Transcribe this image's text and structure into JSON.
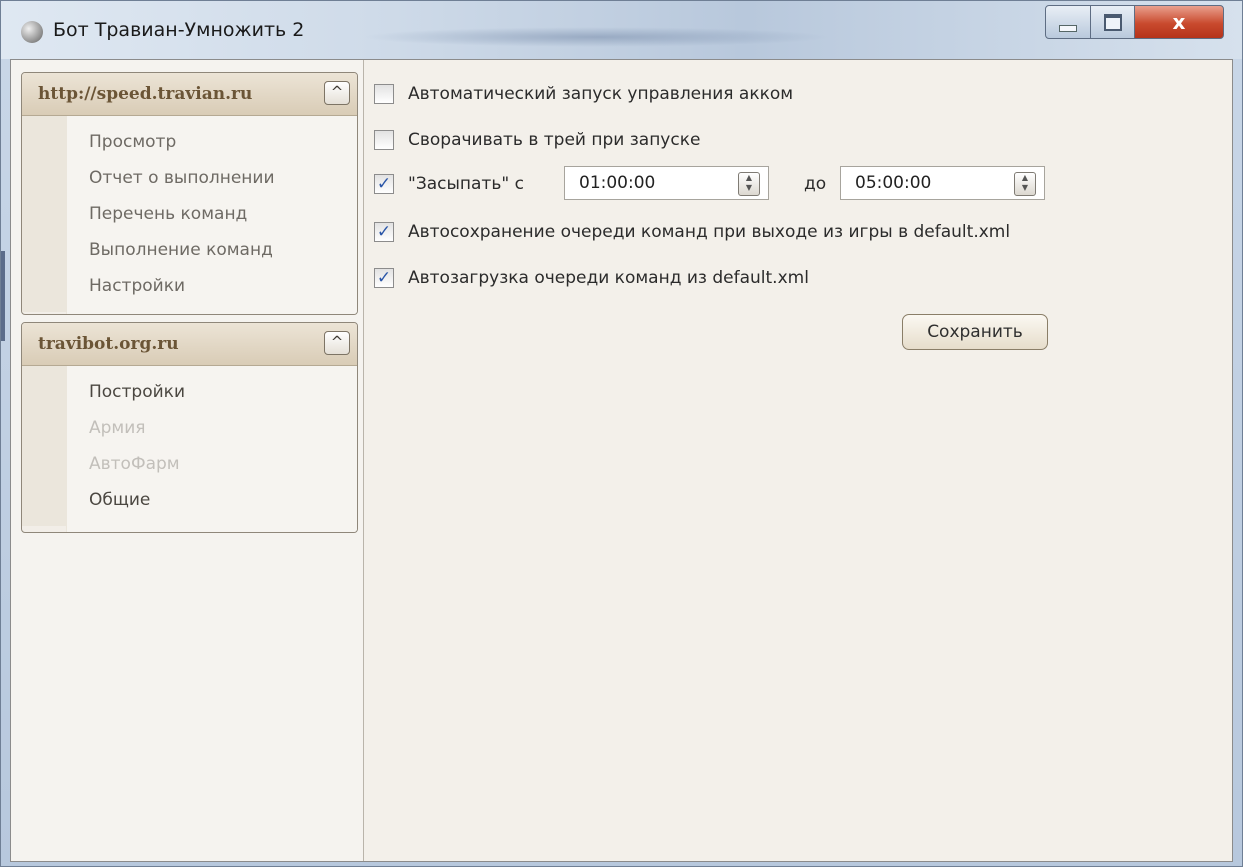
{
  "window": {
    "title": "Бот Травиан-Умножить 2",
    "close_glyph": "x",
    "icon": "app-helmet-icon"
  },
  "sidebar": {
    "panels": [
      {
        "title": "http://speed.travian.ru",
        "collapse_glyph": "^",
        "items": [
          "Просмотр",
          "Отчет о выполнении",
          "Перечень команд",
          "Выполнение команд",
          "Настройки"
        ]
      },
      {
        "title": "travibot.org.ru",
        "collapse_glyph": "^",
        "items": [
          "Постройки",
          "Армия",
          "АвтоФарм",
          "Общие"
        ],
        "disabled_items": [
          "Армия",
          "АвтоФарм"
        ]
      }
    ]
  },
  "settings": {
    "auto_start": {
      "label": "Автоматический запуск управления акком",
      "checked": false
    },
    "minimize_tray": {
      "label": "Сворачивать в трей при запуске",
      "checked": false
    },
    "sleep": {
      "label": "\"Засыпать\" с",
      "checked": true,
      "from": "01:00:00",
      "to_label": "до",
      "to": "05:00:00"
    },
    "autosave": {
      "label": "Автосохранение очереди команд при выходе из игры в default.xml",
      "checked": true
    },
    "autoload": {
      "label": "Автозагрузка очереди команд из default.xml",
      "checked": true
    },
    "check_glyph": "✓",
    "save_label": "Сохранить"
  }
}
